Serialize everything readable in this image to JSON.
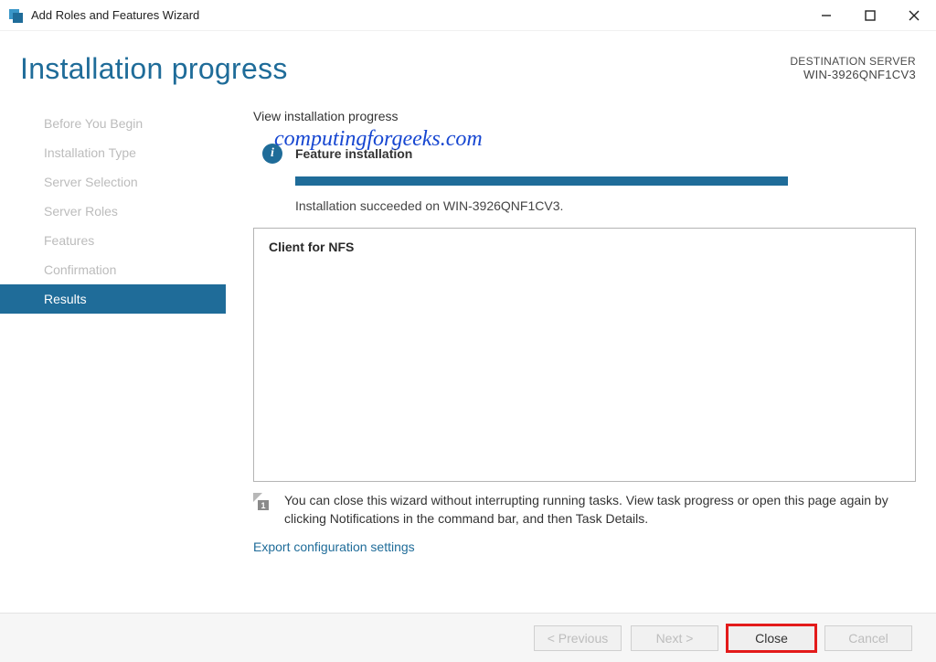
{
  "window": {
    "title": "Add Roles and Features Wizard"
  },
  "header": {
    "pageTitle": "Installation progress",
    "destLabel": "DESTINATION SERVER",
    "destServer": "WIN-3926QNF1CV3"
  },
  "watermark": "computingforgeeks.com",
  "sidebar": {
    "items": [
      {
        "label": "Before You Begin"
      },
      {
        "label": "Installation Type"
      },
      {
        "label": "Server Selection"
      },
      {
        "label": "Server Roles"
      },
      {
        "label": "Features"
      },
      {
        "label": "Confirmation"
      },
      {
        "label": "Results"
      }
    ],
    "activeIndex": 6
  },
  "main": {
    "sectionLabel": "View installation progress",
    "statusTitle": "Feature installation",
    "resultText": "Installation succeeded on WIN-3926QNF1CV3.",
    "featureName": "Client for NFS",
    "hint": "You can close this wizard without interrupting running tasks. View task progress or open this page again by clicking Notifications in the command bar, and then Task Details.",
    "hintBadge": "1",
    "exportLink": "Export configuration settings"
  },
  "buttons": {
    "previous": "< Previous",
    "next": "Next >",
    "close": "Close",
    "cancel": "Cancel"
  },
  "colors": {
    "accent": "#1f6c99",
    "highlight": "#e31b1b"
  }
}
